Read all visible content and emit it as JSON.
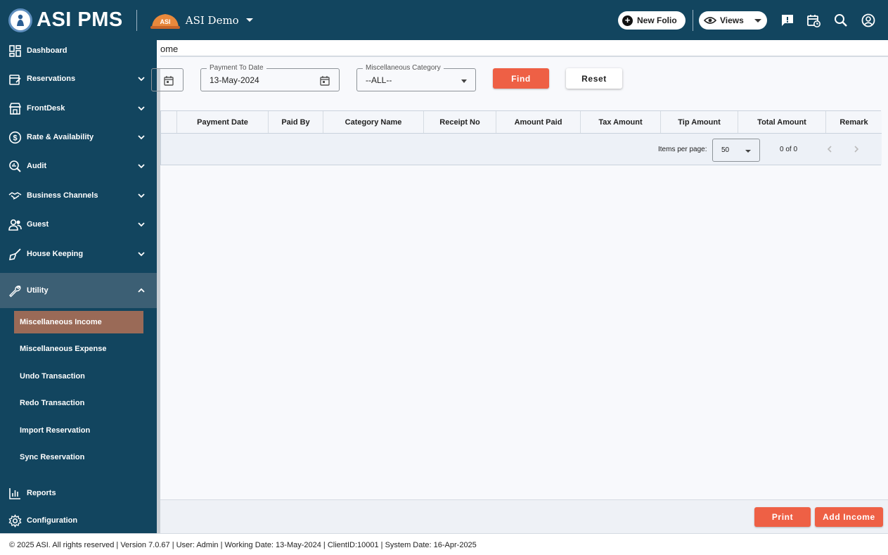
{
  "app": {
    "logo_text": "ASI PMS",
    "hotel_logo_text": "ASI",
    "hotel_name": "ASI Demo"
  },
  "header": {
    "new_folio_label": "New Folio",
    "views_label": "Views",
    "icons": [
      "feedback-icon",
      "calendar-clock-icon",
      "search-icon",
      "account-icon"
    ]
  },
  "sidebar": {
    "items": [
      {
        "label": "Dashboard",
        "icon": "dashboard-icon"
      },
      {
        "label": "Reservations",
        "icon": "reservation-icon"
      },
      {
        "label": "FrontDesk",
        "icon": "frontdesk-icon"
      },
      {
        "label": "Rate & Availability",
        "icon": "dollar-icon"
      },
      {
        "label": "Audit",
        "icon": "audit-icon"
      },
      {
        "label": "Business Channels",
        "icon": "handshake-icon"
      },
      {
        "label": "Guest",
        "icon": "guest-icon"
      },
      {
        "label": "House Keeping",
        "icon": "broom-icon"
      },
      {
        "label": "Utility",
        "icon": "wrench-icon"
      },
      {
        "label": "Reports",
        "icon": "chart-icon"
      },
      {
        "label": "Configuration",
        "icon": "gear-icon"
      }
    ],
    "utility_sub": [
      "Miscellaneous Income",
      "Miscellaneous Expense",
      "Undo Transaction",
      "Redo Transaction",
      "Import Reservation",
      "Sync Reservation"
    ]
  },
  "main": {
    "breadcrumb": "ome",
    "payment_to_date": {
      "label": "Payment To Date",
      "value": "13-May-2024"
    },
    "misc_category": {
      "label": "Miscellaneous Category",
      "value": "--ALL--"
    },
    "find_label": "Find",
    "reset_label": "Reset",
    "table": {
      "columns": [
        "Payment Date",
        "Paid By",
        "Category Name",
        "Receipt No",
        "Amount Paid",
        "Tax Amount",
        "Tip Amount",
        "Total Amount",
        "Remark"
      ],
      "items_per_page_label": "Items per page:",
      "items_per_page": "50",
      "range": "0 of 0"
    },
    "print_label": "Print",
    "add_income_label": "Add Income"
  },
  "footer": {
    "text": "© 2025 ASI. All rights reserved | Version 7.0.67 | User: Admin | Working Date: 13-May-2024 | ClientID:10001 | System Date: 16-Apr-2025"
  }
}
